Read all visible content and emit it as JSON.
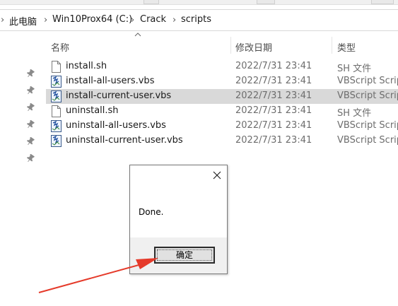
{
  "breadcrumb": {
    "items": [
      {
        "label": "此电脑"
      },
      {
        "label": "Win10Prox64 (C:)"
      },
      {
        "label": "Crack"
      },
      {
        "label": "scripts"
      }
    ]
  },
  "columns": {
    "name": "名称",
    "date_modified": "修改日期",
    "type": "类型"
  },
  "files": [
    {
      "name": "install.sh",
      "date": "2022/7/31 23:41",
      "type": "SH 文件",
      "icon": "sh-file-icon",
      "selected": false
    },
    {
      "name": "install-all-users.vbs",
      "date": "2022/7/31 23:41",
      "type": "VBScript Script",
      "icon": "vbs-file-icon",
      "selected": false
    },
    {
      "name": "install-current-user.vbs",
      "date": "2022/7/31 23:41",
      "type": "VBScript Script",
      "icon": "vbs-file-icon",
      "selected": true
    },
    {
      "name": "uninstall.sh",
      "date": "2022/7/31 23:41",
      "type": "SH 文件",
      "icon": "sh-file-icon",
      "selected": false
    },
    {
      "name": "uninstall-all-users.vbs",
      "date": "2022/7/31 23:41",
      "type": "VBScript Script",
      "icon": "vbs-file-icon",
      "selected": false
    },
    {
      "name": "uninstall-current-user.vbs",
      "date": "2022/7/31 23:41",
      "type": "VBScript Script",
      "icon": "vbs-file-icon",
      "selected": false
    }
  ],
  "dialog": {
    "message": "Done.",
    "ok_label": "确定"
  },
  "colors": {
    "selection": "#d9d9d9",
    "annotation_arrow": "#e53a2a"
  }
}
